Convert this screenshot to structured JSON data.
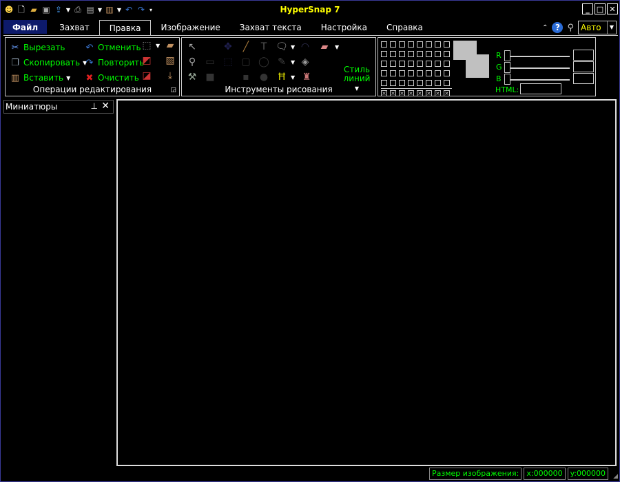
{
  "app": {
    "title": "HyperSnap 7"
  },
  "quick_access": {
    "icons": [
      "app-logo-icon",
      "new-file-icon",
      "open-folder-icon",
      "save-icon",
      "upload-icon",
      "print-icon",
      "copy-image-icon",
      "paste-icon",
      "undo-icon",
      "redo-icon",
      "customize-icon"
    ]
  },
  "window_buttons": {
    "minimize": "_",
    "maximize": "□",
    "close": "✕"
  },
  "tabs": [
    {
      "label": "Файл"
    },
    {
      "label": "Захват"
    },
    {
      "label": "Правка"
    },
    {
      "label": "Изображение"
    },
    {
      "label": "Захват текста"
    },
    {
      "label": "Настройка"
    },
    {
      "label": "Справка"
    }
  ],
  "zoom_combo": {
    "value": "Авто"
  },
  "edit_group": {
    "title": "Операции редактирования",
    "cut": "Вырезать",
    "copy": "Скопировать",
    "paste": "Вставить",
    "undo": "Отменить",
    "redo": "Повторить",
    "clear": "Очистить"
  },
  "draw_group": {
    "title": "Инструменты рисования",
    "line_style": "Стиль линий"
  },
  "color_group": {
    "r_label": "R",
    "g_label": "G",
    "b_label": "B",
    "html_label": "HTML:",
    "colors": {
      "foreground": "#c0c0c0",
      "background": "#c0c0c0"
    }
  },
  "thumbnails_panel": {
    "title": "Миниатюры"
  },
  "status": {
    "image_size_label": "Размер изображения:",
    "x": "x:000000",
    "y": "y:000000"
  },
  "accent_colors": {
    "label_green": "#00ff00",
    "title_yellow": "#ffff00",
    "file_tab": "#0d1a6b"
  }
}
